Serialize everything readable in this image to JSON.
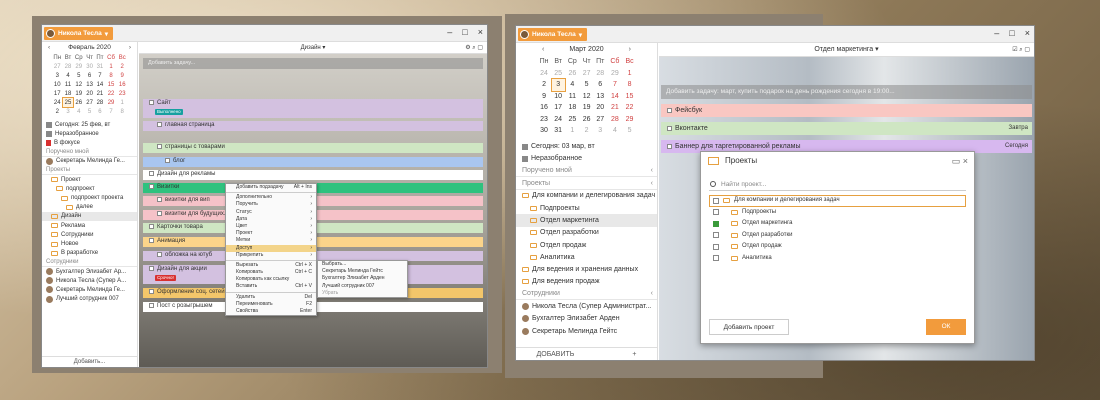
{
  "win1": {
    "user": "Никола Тесла",
    "month": "Февраль 2020",
    "weekdays": [
      "Пн",
      "Вт",
      "Ср",
      "Чт",
      "Пт",
      "Сб",
      "Вс"
    ],
    "weeks": [
      [
        "27",
        "28",
        "29",
        "30",
        "31",
        "1",
        "2"
      ],
      [
        "3",
        "4",
        "5",
        "6",
        "7",
        "8",
        "9"
      ],
      [
        "10",
        "11",
        "12",
        "13",
        "14",
        "15",
        "16"
      ],
      [
        "17",
        "18",
        "19",
        "20",
        "21",
        "22",
        "23"
      ],
      [
        "24",
        "25",
        "26",
        "27",
        "28",
        "29",
        "1"
      ],
      [
        "2",
        "3",
        "4",
        "5",
        "6",
        "7",
        "8"
      ]
    ],
    "side": [
      "Сегодня: 25 фев, вт",
      "Неразобранное",
      "В фокусе",
      "Поручено мной",
      "Секретарь Мелинда Ге...",
      "Проекты",
      "Проект",
      "подпроект",
      "подпроект проекта",
      "далее",
      "Дизайн",
      "Реклама",
      "Сотрудники",
      "Новое",
      "В разработке",
      "Сотрудники",
      "Бухгалтер Элизабет Ар...",
      "Никола Тесла (Супер А...",
      "Секретарь Мелинда Ге...",
      "Лучший сотрудник 007"
    ],
    "add_label": "Добавить...",
    "header": "Дизайн",
    "add_task": "Добавить задачу...",
    "rows": [
      "Сайт",
      "главная страница",
      "страницы с товарами",
      "блог",
      "Дизайн для рекламы",
      "Визитки",
      "визитки для вип",
      "визитки для будущих...",
      "Карточки товара",
      "Анимация",
      "обложка на ютуб",
      "Дизайн для акции",
      "Оформление соц. сетей",
      "Пост с розыгрышем"
    ],
    "badges": {
      "site": "Выполнено",
      "main": "Выполнено",
      "sale": "Срочно!",
      "post": "Срочно!"
    },
    "ctx": [
      [
        "Добавить подзадачу",
        "Alt + Ins"
      ],
      [
        "Дополнительно",
        "›"
      ],
      [
        "Поручить",
        "›"
      ],
      [
        "Статус",
        "›"
      ],
      [
        "Дата",
        "›"
      ],
      [
        "Цвет",
        "›"
      ],
      [
        "Проект",
        "›"
      ],
      [
        "Метки",
        "›"
      ],
      [
        "Доступ",
        "›"
      ],
      [
        "Прикрепить",
        "›"
      ],
      [
        "Вырезать",
        "Ctrl + X"
      ],
      [
        "Копировать",
        "Ctrl + C"
      ],
      [
        "Копировать как ссылку",
        ""
      ],
      [
        "Вставить",
        "Ctrl + V"
      ],
      [
        "Удалить",
        "Del"
      ],
      [
        "Переименовать",
        "F2"
      ],
      [
        "Свойства",
        "Enter"
      ]
    ],
    "sub": [
      "Выбрать...",
      "Секретарь Мелинда Гейтс",
      "Бухгалтер Элизабет Арден",
      "Лучший сотрудник 007",
      "Убрать"
    ]
  },
  "win2": {
    "user": "Никола Тесла",
    "month": "Март 2020",
    "weekdays": [
      "Пн",
      "Вт",
      "Ср",
      "Чт",
      "Пт",
      "Сб",
      "Вс"
    ],
    "weeks": [
      [
        "24",
        "25",
        "26",
        "27",
        "28",
        "29",
        "1"
      ],
      [
        "2",
        "3",
        "4",
        "5",
        "6",
        "7",
        "8"
      ],
      [
        "9",
        "10",
        "11",
        "12",
        "13",
        "14",
        "15"
      ],
      [
        "16",
        "17",
        "18",
        "19",
        "20",
        "21",
        "22"
      ],
      [
        "23",
        "24",
        "25",
        "26",
        "27",
        "28",
        "29"
      ],
      [
        "30",
        "31",
        "1",
        "2",
        "3",
        "4",
        "5"
      ]
    ],
    "side": [
      "Сегодня: 03 мар, вт",
      "Неразобранное",
      "Поручено мной",
      "Проекты",
      "Для компании и делегирования задач",
      "Подпроекты",
      "Отдел маркетинга",
      "Отдел разработки",
      "Отдел продаж",
      "Аналитика",
      "Для ведения и хранения данных",
      "Для ведения продаж",
      "Сотрудники",
      "Никола Тесла (Супер Администрат...",
      "Бухгалтер Элизабет Арден",
      "Секретарь Мелинда Гейтс"
    ],
    "add_label": "ДОБАВИТЬ",
    "header": "Отдел маркетинга",
    "add_task": "Добавить задачу: март, купить подарок на день рождения сегодня в 19:00...",
    "rows": [
      "Фейсбук",
      "Вконтакте",
      "Баннер для таргетированной рекламы"
    ],
    "due": [
      "Завтра",
      "Сегодня"
    ],
    "dialog": {
      "title": "Проекты",
      "search": "Найти проект...",
      "items": [
        "Для компании и делегирования задач",
        "Подпроекты",
        "Отдел маркетинга",
        "Отдел разработки",
        "Отдел продаж",
        "Аналитика"
      ],
      "add": "Добавить проект",
      "ok": "ОК"
    }
  }
}
